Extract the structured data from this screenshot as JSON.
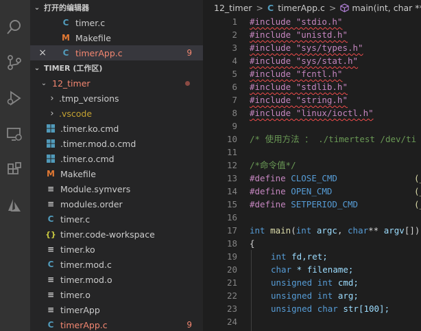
{
  "activity_bar": {
    "icons": [
      "search-icon",
      "source-control-icon",
      "run-debug-icon",
      "remote-explorer-icon",
      "extensions-icon",
      "azure-icon"
    ]
  },
  "sidebar": {
    "open_editors_header": "打开的编辑器",
    "open_editors": [
      {
        "name": "timer.c",
        "icon": "C",
        "kind": "c"
      },
      {
        "name": "Makefile",
        "icon": "M",
        "kind": "make"
      },
      {
        "name": "timerApp.c",
        "icon": "C",
        "kind": "c",
        "badge": "9",
        "close": "×"
      }
    ],
    "workspace_header": "TIMER (工作区)",
    "folder": {
      "name": "12_timer"
    },
    "items": [
      {
        "name": ".tmp_versions",
        "type": "folder"
      },
      {
        "name": ".vscode",
        "type": "folder"
      },
      {
        "name": ".timer.ko.cmd",
        "type": "win"
      },
      {
        "name": ".timer.mod.o.cmd",
        "type": "win"
      },
      {
        "name": ".timer.o.cmd",
        "type": "win"
      },
      {
        "name": "Makefile",
        "type": "make"
      },
      {
        "name": "Module.symvers",
        "type": "lines"
      },
      {
        "name": "modules.order",
        "type": "lines"
      },
      {
        "name": "timer.c",
        "type": "c"
      },
      {
        "name": "timer.code-workspace",
        "type": "json"
      },
      {
        "name": "timer.ko",
        "type": "lines"
      },
      {
        "name": "timer.mod.c",
        "type": "c"
      },
      {
        "name": "timer.mod.o",
        "type": "lines"
      },
      {
        "name": "timer.o",
        "type": "lines"
      },
      {
        "name": "timerApp",
        "type": "lines"
      },
      {
        "name": "timerApp.c",
        "type": "c",
        "badge": "9"
      }
    ]
  },
  "breadcrumb": {
    "folder": "12_timer",
    "sep": ">",
    "file": "timerApp.c",
    "symbol": "main(int, char ** [])"
  },
  "code": {
    "line_numbers": [
      "1",
      "2",
      "3",
      "4",
      "5",
      "6",
      "7",
      "8",
      "9",
      "10",
      "11",
      "12",
      "13",
      "14",
      "15",
      "16",
      "17",
      "18",
      "19",
      "20",
      "21",
      "22",
      "23",
      "24"
    ],
    "includes": [
      "#include \"stdio.h\"",
      "#include \"unistd.h\"",
      "#include \"sys/types.h\"",
      "#include \"sys/stat.h\"",
      "#include \"fcntl.h\"",
      "#include \"stdlib.h\"",
      "#include \"string.h\"",
      "#include \"linux/ioctl.h\""
    ],
    "comment1": "/* 使用方法 ： ./timertest /dev/ti",
    "comment2": "/*命令值*/",
    "defines": [
      {
        "kw": "#define",
        "name": "CLOSE_CMD",
        "tail": "(_"
      },
      {
        "kw": "#define",
        "name": "OPEN_CMD",
        "tail": "(_"
      },
      {
        "kw": "#define",
        "name": "SETPERIOD_CMD",
        "tail": "(_"
      }
    ],
    "main_sig": {
      "t1": "int",
      "fn": "main",
      "t2": "int",
      "a1": "argc",
      "t3": "char",
      "a2": "argv",
      "rest": "[]),"
    },
    "brace": "{",
    "decls": [
      {
        "type": "int",
        "rest": "fd,ret;"
      },
      {
        "type": "char",
        "rest": "* filename;"
      },
      {
        "type": "unsigned int",
        "rest": "cmd;"
      },
      {
        "type": "unsigned int",
        "rest": "arg;"
      },
      {
        "type": "unsigned char",
        "rest": "str[100];"
      }
    ]
  }
}
